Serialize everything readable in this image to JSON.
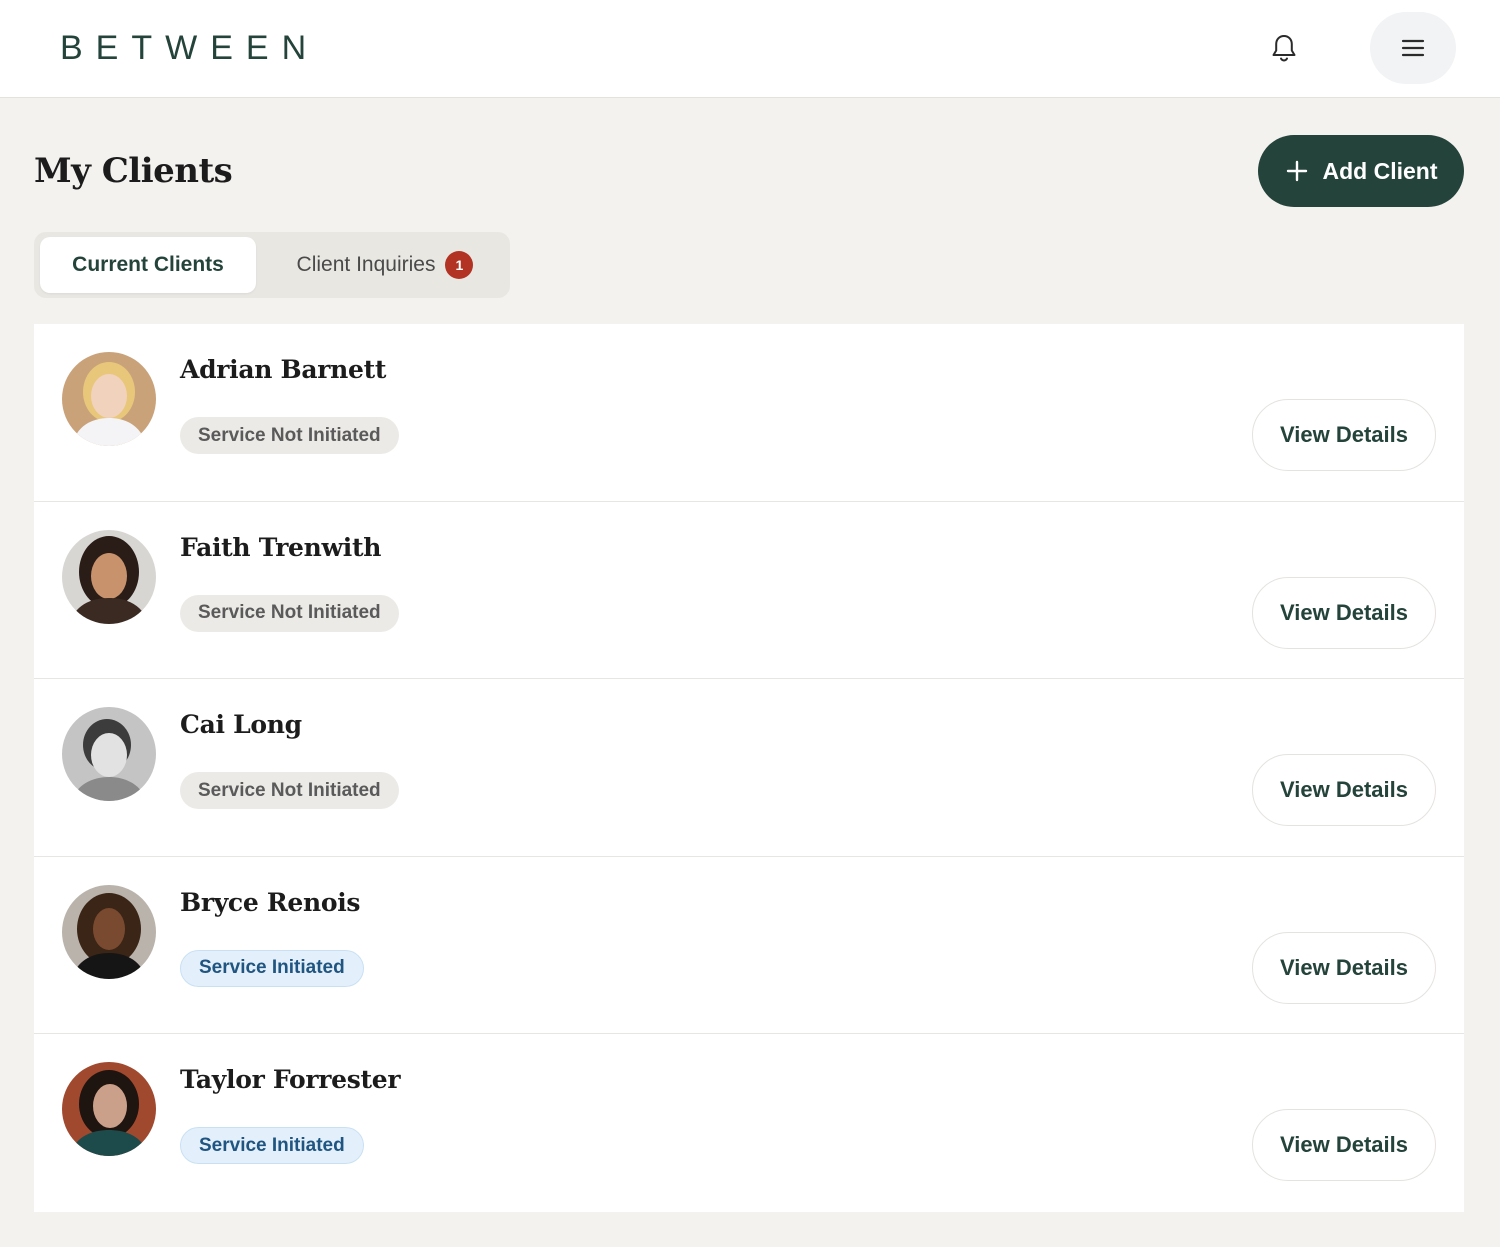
{
  "header": {
    "logo": "BETWEEN",
    "notification_icon": "bell-icon",
    "menu_icon": "hamburger-menu-icon"
  },
  "page": {
    "title": "My Clients",
    "add_button_label": "Add Client",
    "add_button_icon": "plus-icon"
  },
  "tabs": [
    {
      "label": "Current Clients",
      "active": true
    },
    {
      "label": "Client Inquiries",
      "active": false,
      "badge": "1"
    }
  ],
  "clients": [
    {
      "name": "Adrian Barnett",
      "status": "Service Not Initiated",
      "status_type": "not-initiated",
      "action": "View Details"
    },
    {
      "name": "Faith Trenwith",
      "status": "Service Not Initiated",
      "status_type": "not-initiated",
      "action": "View Details"
    },
    {
      "name": "Cai Long",
      "status": "Service Not Initiated",
      "status_type": "not-initiated",
      "action": "View Details"
    },
    {
      "name": "Bryce Renois",
      "status": "Service Initiated",
      "status_type": "initiated",
      "action": "View Details"
    },
    {
      "name": "Taylor Forrester",
      "status": "Service Initiated",
      "status_type": "initiated",
      "action": "View Details"
    }
  ],
  "colors": {
    "brand": "#24433a",
    "background": "#f3f2ef",
    "badge": "#b23323",
    "status_initiated_bg": "#e3f0fb",
    "status_not_initiated_bg": "#eceae6"
  }
}
